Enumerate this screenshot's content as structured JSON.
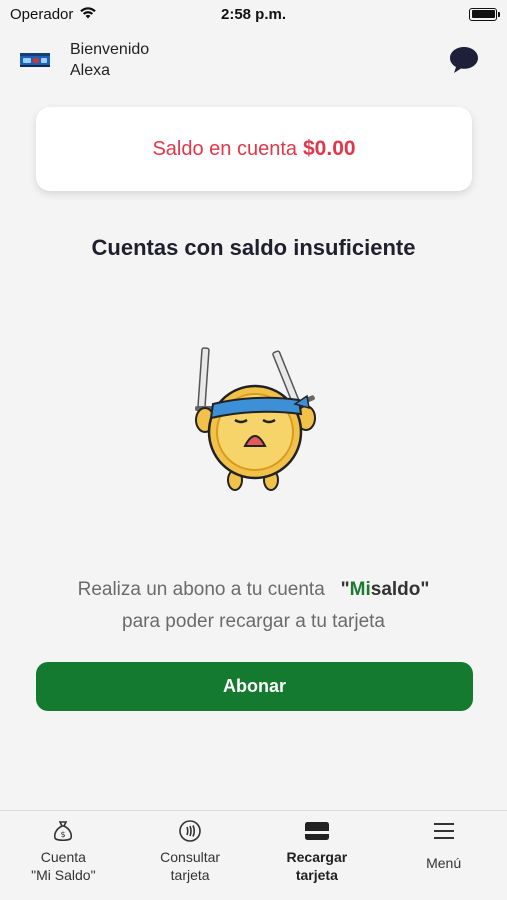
{
  "status_bar": {
    "carrier": "Operador",
    "time": "2:58 p.m."
  },
  "header": {
    "greeting_line1": "Bienvenido",
    "greeting_line2": "Alexa",
    "avatar_icon": "card-icon",
    "chat_icon": "chat-bubble-icon"
  },
  "balance": {
    "label": "Saldo en cuenta",
    "amount": "$0.00",
    "color": "#e0384a"
  },
  "main": {
    "title": "Cuentas con saldo insuficiente",
    "message_part1": "Realiza un abono a tu cuenta",
    "brand_open_quote": "\"",
    "brand_mi": "Mi",
    "brand_saldo": "saldo",
    "brand_close_quote": "\"",
    "message_part2": "para poder recargar a tu tarjeta",
    "button_label": "Abonar",
    "button_color": "#137a2f"
  },
  "bottom_nav": {
    "items": [
      {
        "label": "Cuenta\n\"Mi Saldo\"",
        "icon": "money-bag-icon",
        "active": false
      },
      {
        "label": "Consultar\ntarjeta",
        "icon": "nfc-card-icon",
        "active": false
      },
      {
        "label": "Recargar\ntarjeta",
        "icon": "card-icon",
        "active": true
      },
      {
        "label": "Menú",
        "icon": "hamburger-menu-icon",
        "active": false
      }
    ]
  }
}
